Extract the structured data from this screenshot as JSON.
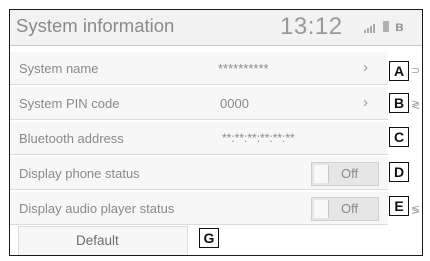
{
  "header": {
    "title": "System information",
    "time": "13:12"
  },
  "status_icons": [
    "signal-icon",
    "battery-icon",
    "bluetooth-icon"
  ],
  "rows": [
    {
      "label": "System name",
      "value": "**********",
      "callout": "A"
    },
    {
      "label": "System PIN code",
      "value": "0000",
      "callout": "B"
    },
    {
      "label": "Bluetooth address",
      "value": "**:**:**:**:**:**",
      "callout": "C"
    },
    {
      "label": "Display phone status",
      "value": "Off",
      "callout": "D"
    },
    {
      "label": "Display audio player status",
      "value": "Off",
      "callout": "E"
    }
  ],
  "default_button": {
    "label": "Default",
    "callout": "G"
  }
}
